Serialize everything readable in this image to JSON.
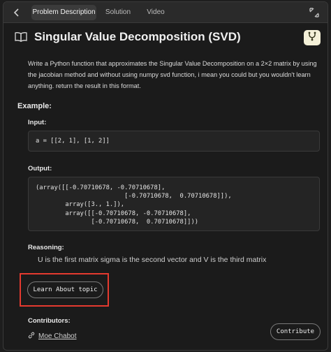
{
  "tabs": {
    "back_icon": "chevron-left-icon",
    "items": [
      {
        "label": "Problem Description",
        "active": true
      },
      {
        "label": "Solution",
        "active": false
      },
      {
        "label": "Video",
        "active": false
      }
    ],
    "expand_icon": "expand-icon"
  },
  "problem": {
    "title": "Singular Value Decomposition (SVD)",
    "title_icon": "book-icon",
    "action_icon": "merge-icon",
    "description": "Write a Python function that approximates the Singular Value Decomposition on a 2×2 matrix by using the jacobian method and without using numpy svd function, i mean you could but you wouldn't learn anything. return the result in this format."
  },
  "example": {
    "heading": "Example:",
    "input_label": "Input:",
    "input_code": "a = [[2, 1], [1, 2]]",
    "output_label": "Output:",
    "output_code": "(array([[-0.70710678, -0.70710678],\n                        [-0.70710678,  0.70710678]]),\n        array([3., 1.]),\n        array([[-0.70710678, -0.70710678],\n               [-0.70710678,  0.70710678]]))",
    "reasoning_label": "Reasoning:",
    "reasoning_text": "U is the first matrix sigma is the second vector and V is the third matrix"
  },
  "learn_button": "Learn About topic",
  "contributors": {
    "heading": "Contributors:",
    "name": "Moe Chabot",
    "link_icon": "link-icon"
  },
  "contribute_button": "Contribute",
  "colors": {
    "highlight": "#e53a2f",
    "merge_button_bg": "#f4f0d8"
  }
}
